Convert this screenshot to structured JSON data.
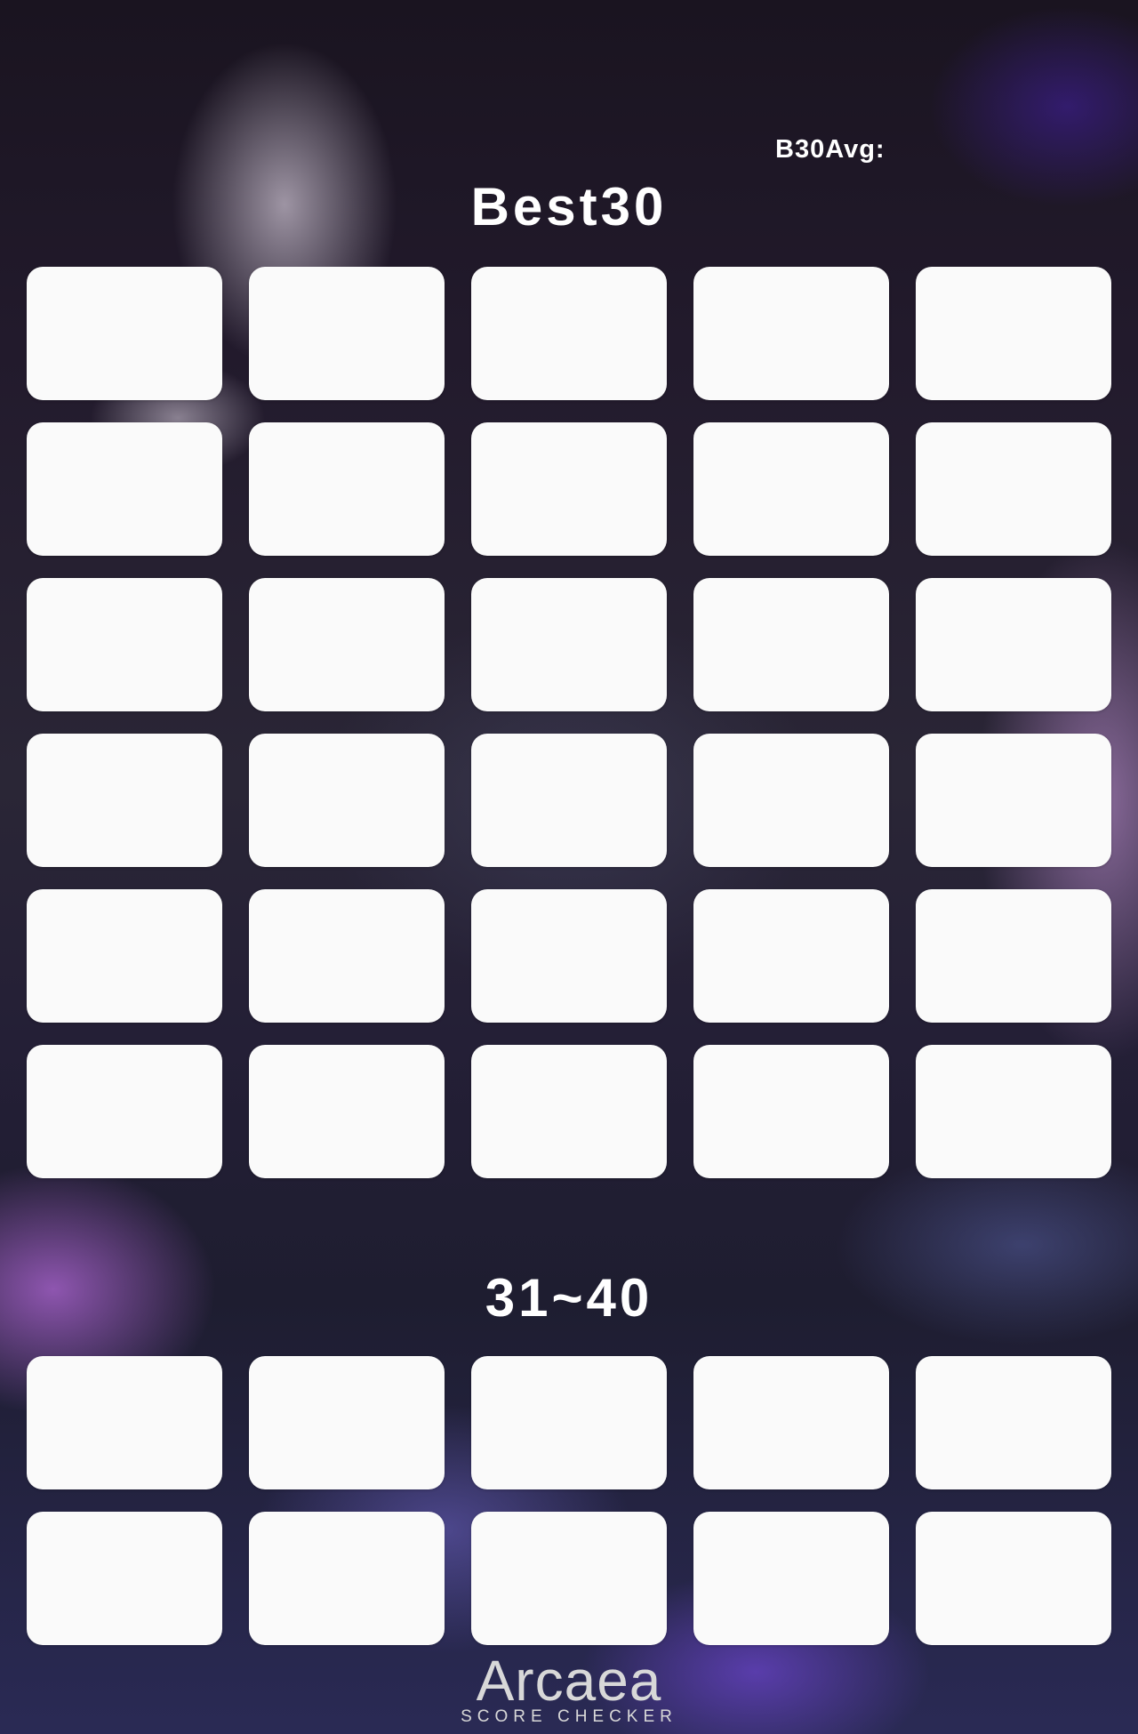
{
  "header": {
    "avg_label": "B30Avg:"
  },
  "sections": [
    {
      "title": "Best30",
      "card_count": 30
    },
    {
      "title": "31~40",
      "card_count": 10
    }
  ],
  "logo": {
    "name": "Arcaea",
    "subtitle": "SCORE CHECKER"
  },
  "colors": {
    "card": "#fafafa",
    "text": "#ffffff"
  }
}
